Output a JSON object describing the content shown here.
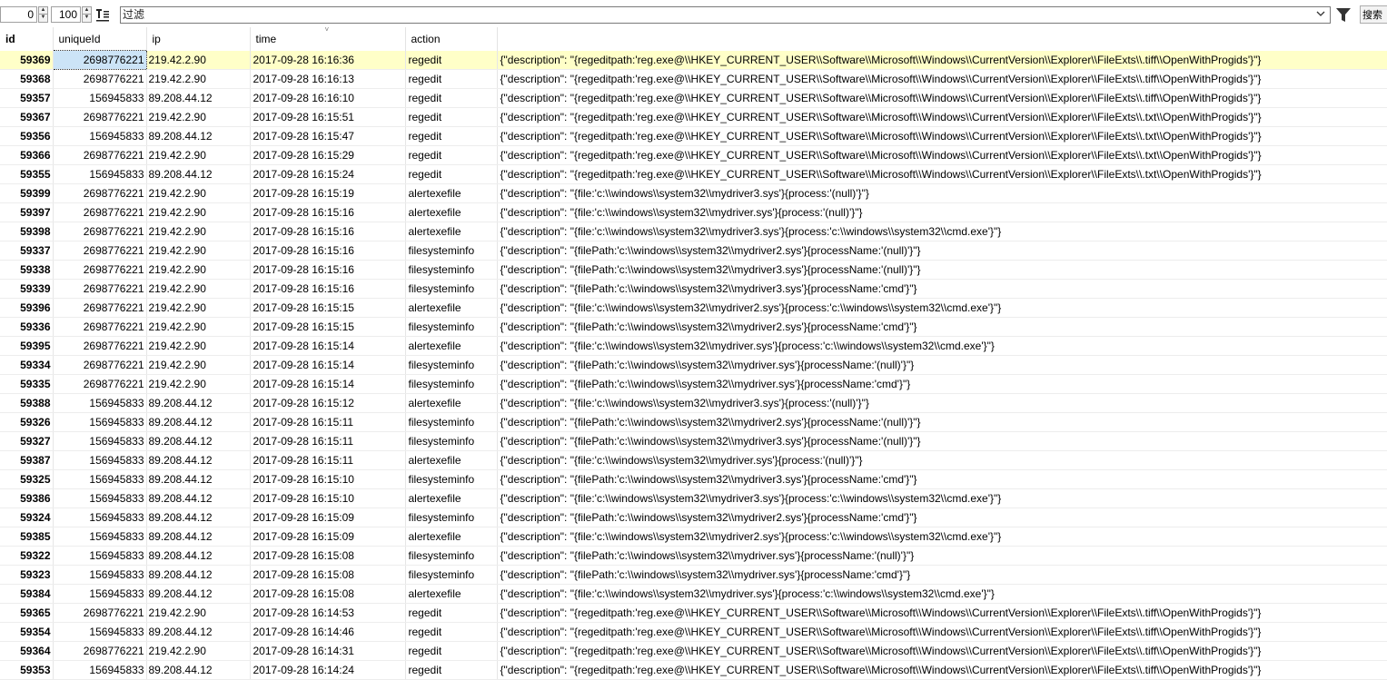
{
  "toolbar": {
    "offset": "0",
    "limit": "100",
    "filter_placeholder": "过滤",
    "search_label": "搜索"
  },
  "columns": [
    "id",
    "uniqueId",
    "ip",
    "time",
    "action",
    ""
  ],
  "rows": [
    [
      "59369",
      "2698776221",
      "219.42.2.90",
      "2017-09-28 16:16:36",
      "regedit",
      "{\"description\": \"{regeditpath:'reg.exe@\\\\HKEY_CURRENT_USER\\\\Software\\\\Microsoft\\\\Windows\\\\CurrentVersion\\\\Explorer\\\\FileExts\\\\.tiff\\\\OpenWithProgids'}\"}"
    ],
    [
      "59368",
      "2698776221",
      "219.42.2.90",
      "2017-09-28 16:16:13",
      "regedit",
      "{\"description\": \"{regeditpath:'reg.exe@\\\\HKEY_CURRENT_USER\\\\Software\\\\Microsoft\\\\Windows\\\\CurrentVersion\\\\Explorer\\\\FileExts\\\\.tiff\\\\OpenWithProgids'}\"}"
    ],
    [
      "59357",
      "156945833",
      "89.208.44.12",
      "2017-09-28 16:16:10",
      "regedit",
      "{\"description\": \"{regeditpath:'reg.exe@\\\\HKEY_CURRENT_USER\\\\Software\\\\Microsoft\\\\Windows\\\\CurrentVersion\\\\Explorer\\\\FileExts\\\\.tiff\\\\OpenWithProgids'}\"}"
    ],
    [
      "59367",
      "2698776221",
      "219.42.2.90",
      "2017-09-28 16:15:51",
      "regedit",
      "{\"description\": \"{regeditpath:'reg.exe@\\\\HKEY_CURRENT_USER\\\\Software\\\\Microsoft\\\\Windows\\\\CurrentVersion\\\\Explorer\\\\FileExts\\\\.txt\\\\OpenWithProgids'}\"}"
    ],
    [
      "59356",
      "156945833",
      "89.208.44.12",
      "2017-09-28 16:15:47",
      "regedit",
      "{\"description\": \"{regeditpath:'reg.exe@\\\\HKEY_CURRENT_USER\\\\Software\\\\Microsoft\\\\Windows\\\\CurrentVersion\\\\Explorer\\\\FileExts\\\\.txt\\\\OpenWithProgids'}\"}"
    ],
    [
      "59366",
      "2698776221",
      "219.42.2.90",
      "2017-09-28 16:15:29",
      "regedit",
      "{\"description\": \"{regeditpath:'reg.exe@\\\\HKEY_CURRENT_USER\\\\Software\\\\Microsoft\\\\Windows\\\\CurrentVersion\\\\Explorer\\\\FileExts\\\\.txt\\\\OpenWithProgids'}\"}"
    ],
    [
      "59355",
      "156945833",
      "89.208.44.12",
      "2017-09-28 16:15:24",
      "regedit",
      "{\"description\": \"{regeditpath:'reg.exe@\\\\HKEY_CURRENT_USER\\\\Software\\\\Microsoft\\\\Windows\\\\CurrentVersion\\\\Explorer\\\\FileExts\\\\.txt\\\\OpenWithProgids'}\"}"
    ],
    [
      "59399",
      "2698776221",
      "219.42.2.90",
      "2017-09-28 16:15:19",
      "alertexefile",
      "{\"description\": \"{file:'c:\\\\windows\\\\system32\\\\mydriver3.sys'}{process:'(null)'}\"}"
    ],
    [
      "59397",
      "2698776221",
      "219.42.2.90",
      "2017-09-28 16:15:16",
      "alertexefile",
      "{\"description\": \"{file:'c:\\\\windows\\\\system32\\\\mydriver.sys'}{process:'(null)'}\"}"
    ],
    [
      "59398",
      "2698776221",
      "219.42.2.90",
      "2017-09-28 16:15:16",
      "alertexefile",
      "{\"description\": \"{file:'c:\\\\windows\\\\system32\\\\mydriver3.sys'}{process:'c:\\\\windows\\\\system32\\\\cmd.exe'}\"}"
    ],
    [
      "59337",
      "2698776221",
      "219.42.2.90",
      "2017-09-28 16:15:16",
      "filesysteminfo",
      "{\"description\": \"{filePath:'c:\\\\windows\\\\system32\\\\mydriver2.sys'}{processName:'(null)'}\"}"
    ],
    [
      "59338",
      "2698776221",
      "219.42.2.90",
      "2017-09-28 16:15:16",
      "filesysteminfo",
      "{\"description\": \"{filePath:'c:\\\\windows\\\\system32\\\\mydriver3.sys'}{processName:'(null)'}\"}"
    ],
    [
      "59339",
      "2698776221",
      "219.42.2.90",
      "2017-09-28 16:15:16",
      "filesysteminfo",
      "{\"description\": \"{filePath:'c:\\\\windows\\\\system32\\\\mydriver3.sys'}{processName:'cmd'}\"}"
    ],
    [
      "59396",
      "2698776221",
      "219.42.2.90",
      "2017-09-28 16:15:15",
      "alertexefile",
      "{\"description\": \"{file:'c:\\\\windows\\\\system32\\\\mydriver2.sys'}{process:'c:\\\\windows\\\\system32\\\\cmd.exe'}\"}"
    ],
    [
      "59336",
      "2698776221",
      "219.42.2.90",
      "2017-09-28 16:15:15",
      "filesysteminfo",
      "{\"description\": \"{filePath:'c:\\\\windows\\\\system32\\\\mydriver2.sys'}{processName:'cmd'}\"}"
    ],
    [
      "59395",
      "2698776221",
      "219.42.2.90",
      "2017-09-28 16:15:14",
      "alertexefile",
      "{\"description\": \"{file:'c:\\\\windows\\\\system32\\\\mydriver.sys'}{process:'c:\\\\windows\\\\system32\\\\cmd.exe'}\"}"
    ],
    [
      "59334",
      "2698776221",
      "219.42.2.90",
      "2017-09-28 16:15:14",
      "filesysteminfo",
      "{\"description\": \"{filePath:'c:\\\\windows\\\\system32\\\\mydriver.sys'}{processName:'(null)'}\"}"
    ],
    [
      "59335",
      "2698776221",
      "219.42.2.90",
      "2017-09-28 16:15:14",
      "filesysteminfo",
      "{\"description\": \"{filePath:'c:\\\\windows\\\\system32\\\\mydriver.sys'}{processName:'cmd'}\"}"
    ],
    [
      "59388",
      "156945833",
      "89.208.44.12",
      "2017-09-28 16:15:12",
      "alertexefile",
      "{\"description\": \"{file:'c:\\\\windows\\\\system32\\\\mydriver3.sys'}{process:'(null)'}\"}"
    ],
    [
      "59326",
      "156945833",
      "89.208.44.12",
      "2017-09-28 16:15:11",
      "filesysteminfo",
      "{\"description\": \"{filePath:'c:\\\\windows\\\\system32\\\\mydriver2.sys'}{processName:'(null)'}\"}"
    ],
    [
      "59327",
      "156945833",
      "89.208.44.12",
      "2017-09-28 16:15:11",
      "filesysteminfo",
      "{\"description\": \"{filePath:'c:\\\\windows\\\\system32\\\\mydriver3.sys'}{processName:'(null)'}\"}"
    ],
    [
      "59387",
      "156945833",
      "89.208.44.12",
      "2017-09-28 16:15:11",
      "alertexefile",
      "{\"description\": \"{file:'c:\\\\windows\\\\system32\\\\mydriver.sys'}{process:'(null)'}\"}"
    ],
    [
      "59325",
      "156945833",
      "89.208.44.12",
      "2017-09-28 16:15:10",
      "filesysteminfo",
      "{\"description\": \"{filePath:'c:\\\\windows\\\\system32\\\\mydriver3.sys'}{processName:'cmd'}\"}"
    ],
    [
      "59386",
      "156945833",
      "89.208.44.12",
      "2017-09-28 16:15:10",
      "alertexefile",
      "{\"description\": \"{file:'c:\\\\windows\\\\system32\\\\mydriver3.sys'}{process:'c:\\\\windows\\\\system32\\\\cmd.exe'}\"}"
    ],
    [
      "59324",
      "156945833",
      "89.208.44.12",
      "2017-09-28 16:15:09",
      "filesysteminfo",
      "{\"description\": \"{filePath:'c:\\\\windows\\\\system32\\\\mydriver2.sys'}{processName:'cmd'}\"}"
    ],
    [
      "59385",
      "156945833",
      "89.208.44.12",
      "2017-09-28 16:15:09",
      "alertexefile",
      "{\"description\": \"{file:'c:\\\\windows\\\\system32\\\\mydriver2.sys'}{process:'c:\\\\windows\\\\system32\\\\cmd.exe'}\"}"
    ],
    [
      "59322",
      "156945833",
      "89.208.44.12",
      "2017-09-28 16:15:08",
      "filesysteminfo",
      "{\"description\": \"{filePath:'c:\\\\windows\\\\system32\\\\mydriver.sys'}{processName:'(null)'}\"}"
    ],
    [
      "59323",
      "156945833",
      "89.208.44.12",
      "2017-09-28 16:15:08",
      "filesysteminfo",
      "{\"description\": \"{filePath:'c:\\\\windows\\\\system32\\\\mydriver.sys'}{processName:'cmd'}\"}"
    ],
    [
      "59384",
      "156945833",
      "89.208.44.12",
      "2017-09-28 16:15:08",
      "alertexefile",
      "{\"description\": \"{file:'c:\\\\windows\\\\system32\\\\mydriver.sys'}{process:'c:\\\\windows\\\\system32\\\\cmd.exe'}\"}"
    ],
    [
      "59365",
      "2698776221",
      "219.42.2.90",
      "2017-09-28 16:14:53",
      "regedit",
      "{\"description\": \"{regeditpath:'reg.exe@\\\\HKEY_CURRENT_USER\\\\Software\\\\Microsoft\\\\Windows\\\\CurrentVersion\\\\Explorer\\\\FileExts\\\\.tiff\\\\OpenWithProgids'}\"}"
    ],
    [
      "59354",
      "156945833",
      "89.208.44.12",
      "2017-09-28 16:14:46",
      "regedit",
      "{\"description\": \"{regeditpath:'reg.exe@\\\\HKEY_CURRENT_USER\\\\Software\\\\Microsoft\\\\Windows\\\\CurrentVersion\\\\Explorer\\\\FileExts\\\\.tiff\\\\OpenWithProgids'}\"}"
    ],
    [
      "59364",
      "2698776221",
      "219.42.2.90",
      "2017-09-28 16:14:31",
      "regedit",
      "{\"description\": \"{regeditpath:'reg.exe@\\\\HKEY_CURRENT_USER\\\\Software\\\\Microsoft\\\\Windows\\\\CurrentVersion\\\\Explorer\\\\FileExts\\\\.tiff\\\\OpenWithProgids'}\"}"
    ],
    [
      "59353",
      "156945833",
      "89.208.44.12",
      "2017-09-28 16:14:24",
      "regedit",
      "{\"description\": \"{regeditpath:'reg.exe@\\\\HKEY_CURRENT_USER\\\\Software\\\\Microsoft\\\\Windows\\\\CurrentVersion\\\\Explorer\\\\FileExts\\\\.tiff\\\\OpenWithProgids'}\"}"
    ]
  ],
  "selected_row": 0,
  "colors": {
    "selected_row_bg": "#ffffc8",
    "selected_cell_bg": "#cce4f7",
    "grid_line": "#e6e6e6"
  },
  "icons": {
    "format": "text-format-icon",
    "filter": "funnel-icon",
    "dropdown": "chevron-down-icon",
    "sort": "sort-indicator-icon"
  }
}
